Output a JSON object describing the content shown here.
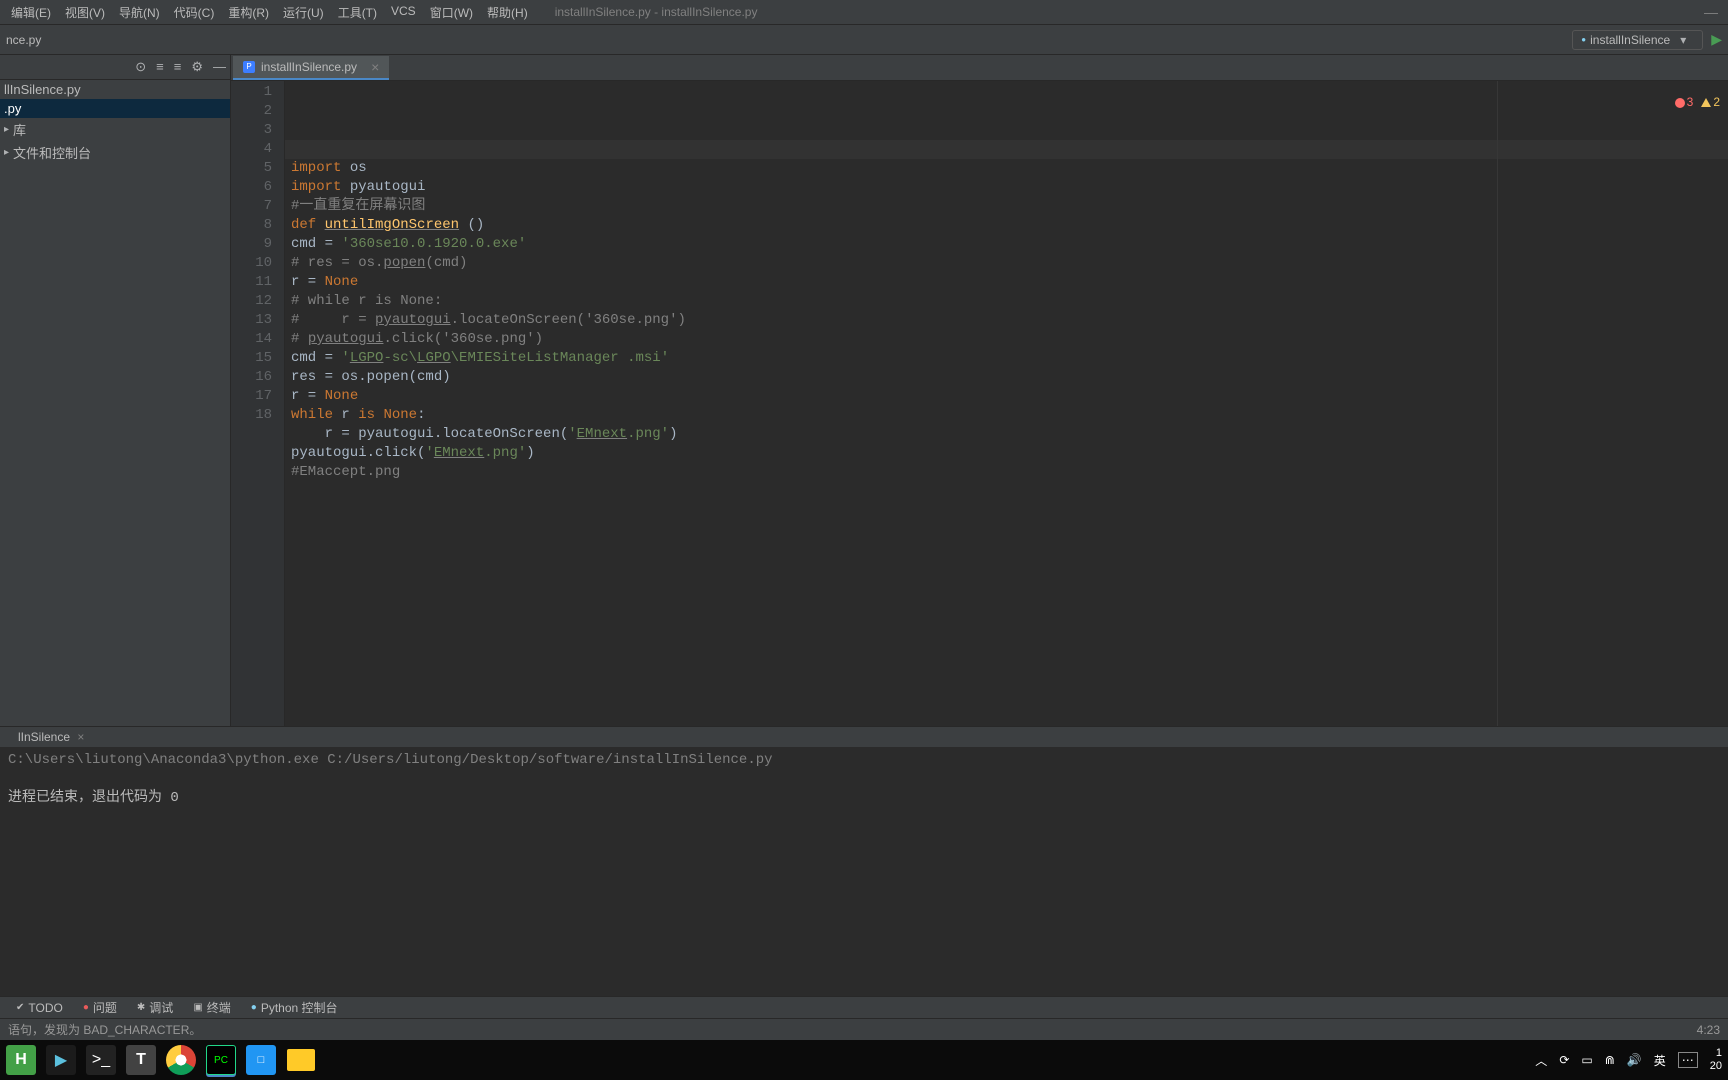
{
  "menu": {
    "items": [
      "编辑(E)",
      "视图(V)",
      "导航(N)",
      "代码(C)",
      "重构(R)",
      "运行(U)",
      "工具(T)",
      "VCS",
      "窗口(W)",
      "帮助(H)"
    ]
  },
  "window_title": "installInSilence.py - installInSilence.py",
  "run_config": {
    "label": "installInSilence"
  },
  "breadcrumb": "nce.py",
  "project": {
    "root": "llInSilence.py",
    "items": [
      ".py"
    ],
    "libs_collapsed": "库",
    "files_collapsed": "文件和控制台"
  },
  "editor_tab": {
    "label": "installInSilence.py"
  },
  "code": {
    "lines": [
      {
        "n": 1,
        "html": "<span class=\"tok-kw\">import</span> os"
      },
      {
        "n": 2,
        "html": "<span class=\"tok-kw\">import</span> pyautogui"
      },
      {
        "n": 3,
        "html": "<span class=\"tok-comment\">#一直重复在屏幕识图</span>"
      },
      {
        "n": 4,
        "html": "<span class=\"tok-kw\">def</span> <span class=\"tok-func tok-underline\">untilImgOnScreen</span> ()"
      },
      {
        "n": 5,
        "html": "cmd = <span class=\"tok-str\">'360se10.0.1920.0.exe'</span>"
      },
      {
        "n": 6,
        "html": "<span class=\"tok-comment\"># res = os.</span><span class=\"tok-underline tok-comment\">popen</span><span class=\"tok-comment\">(cmd)</span>"
      },
      {
        "n": 7,
        "html": "r = <span class=\"tok-kw\">None</span>"
      },
      {
        "n": 8,
        "html": "<span class=\"tok-comment\"># while r is None:</span>"
      },
      {
        "n": 9,
        "html": "<span class=\"tok-comment\">#     r = </span><span class=\"tok-underline tok-comment\">pyautogui</span><span class=\"tok-comment\">.locateOnScreen('360se.png')</span>"
      },
      {
        "n": 10,
        "html": "<span class=\"tok-comment\"># </span><span class=\"tok-underline tok-comment\">pyautogui</span><span class=\"tok-comment\">.click('360se.png')</span>"
      },
      {
        "n": 11,
        "html": "cmd = <span class=\"tok-str\">'</span><span class=\"tok-str tok-underline\">LGPO</span><span class=\"tok-str\">-sc\\</span><span class=\"tok-str tok-underline\">LGPO</span><span class=\"tok-str\">\\EMIESiteListManager .msi'</span>"
      },
      {
        "n": 12,
        "html": "res = os.popen(cmd)"
      },
      {
        "n": 13,
        "html": "r = <span class=\"tok-kw\">None</span>"
      },
      {
        "n": 14,
        "html": "<span class=\"tok-kw\">while</span> r <span class=\"tok-kw\">is</span> <span class=\"tok-kw\">None</span>:"
      },
      {
        "n": 15,
        "html": "    r = pyautogui.locateOnScreen(<span class=\"tok-str\">'</span><span class=\"tok-str tok-underline\">EMnext</span><span class=\"tok-str\">.png'</span>)"
      },
      {
        "n": 16,
        "html": "pyautogui.click(<span class=\"tok-str\">'</span><span class=\"tok-str tok-underline\">EMnext</span><span class=\"tok-str\">.png'</span>)"
      },
      {
        "n": 17,
        "html": "<span class=\"tok-comment\">#EMaccept.png</span>"
      },
      {
        "n": 18,
        "html": ""
      }
    ]
  },
  "indicators": {
    "errors": "3",
    "warnings": "2"
  },
  "run_panel": {
    "tab_name": "lInSilence",
    "cmd_line": "C:\\Users\\liutong\\Anaconda3\\python.exe C:/Users/liutong/Desktop/software/installInSilence.py",
    "exit_msg": "进程已结束，退出代码为 0"
  },
  "tool_buttons": [
    "TODO",
    "问题",
    "调试",
    "终端",
    "Python 控制台"
  ],
  "status": {
    "left": "语句，发现为 BAD_CHARACTER。",
    "cursor": "4:23"
  },
  "systray": {
    "ime": "英",
    "time": "1",
    "date": "20"
  }
}
